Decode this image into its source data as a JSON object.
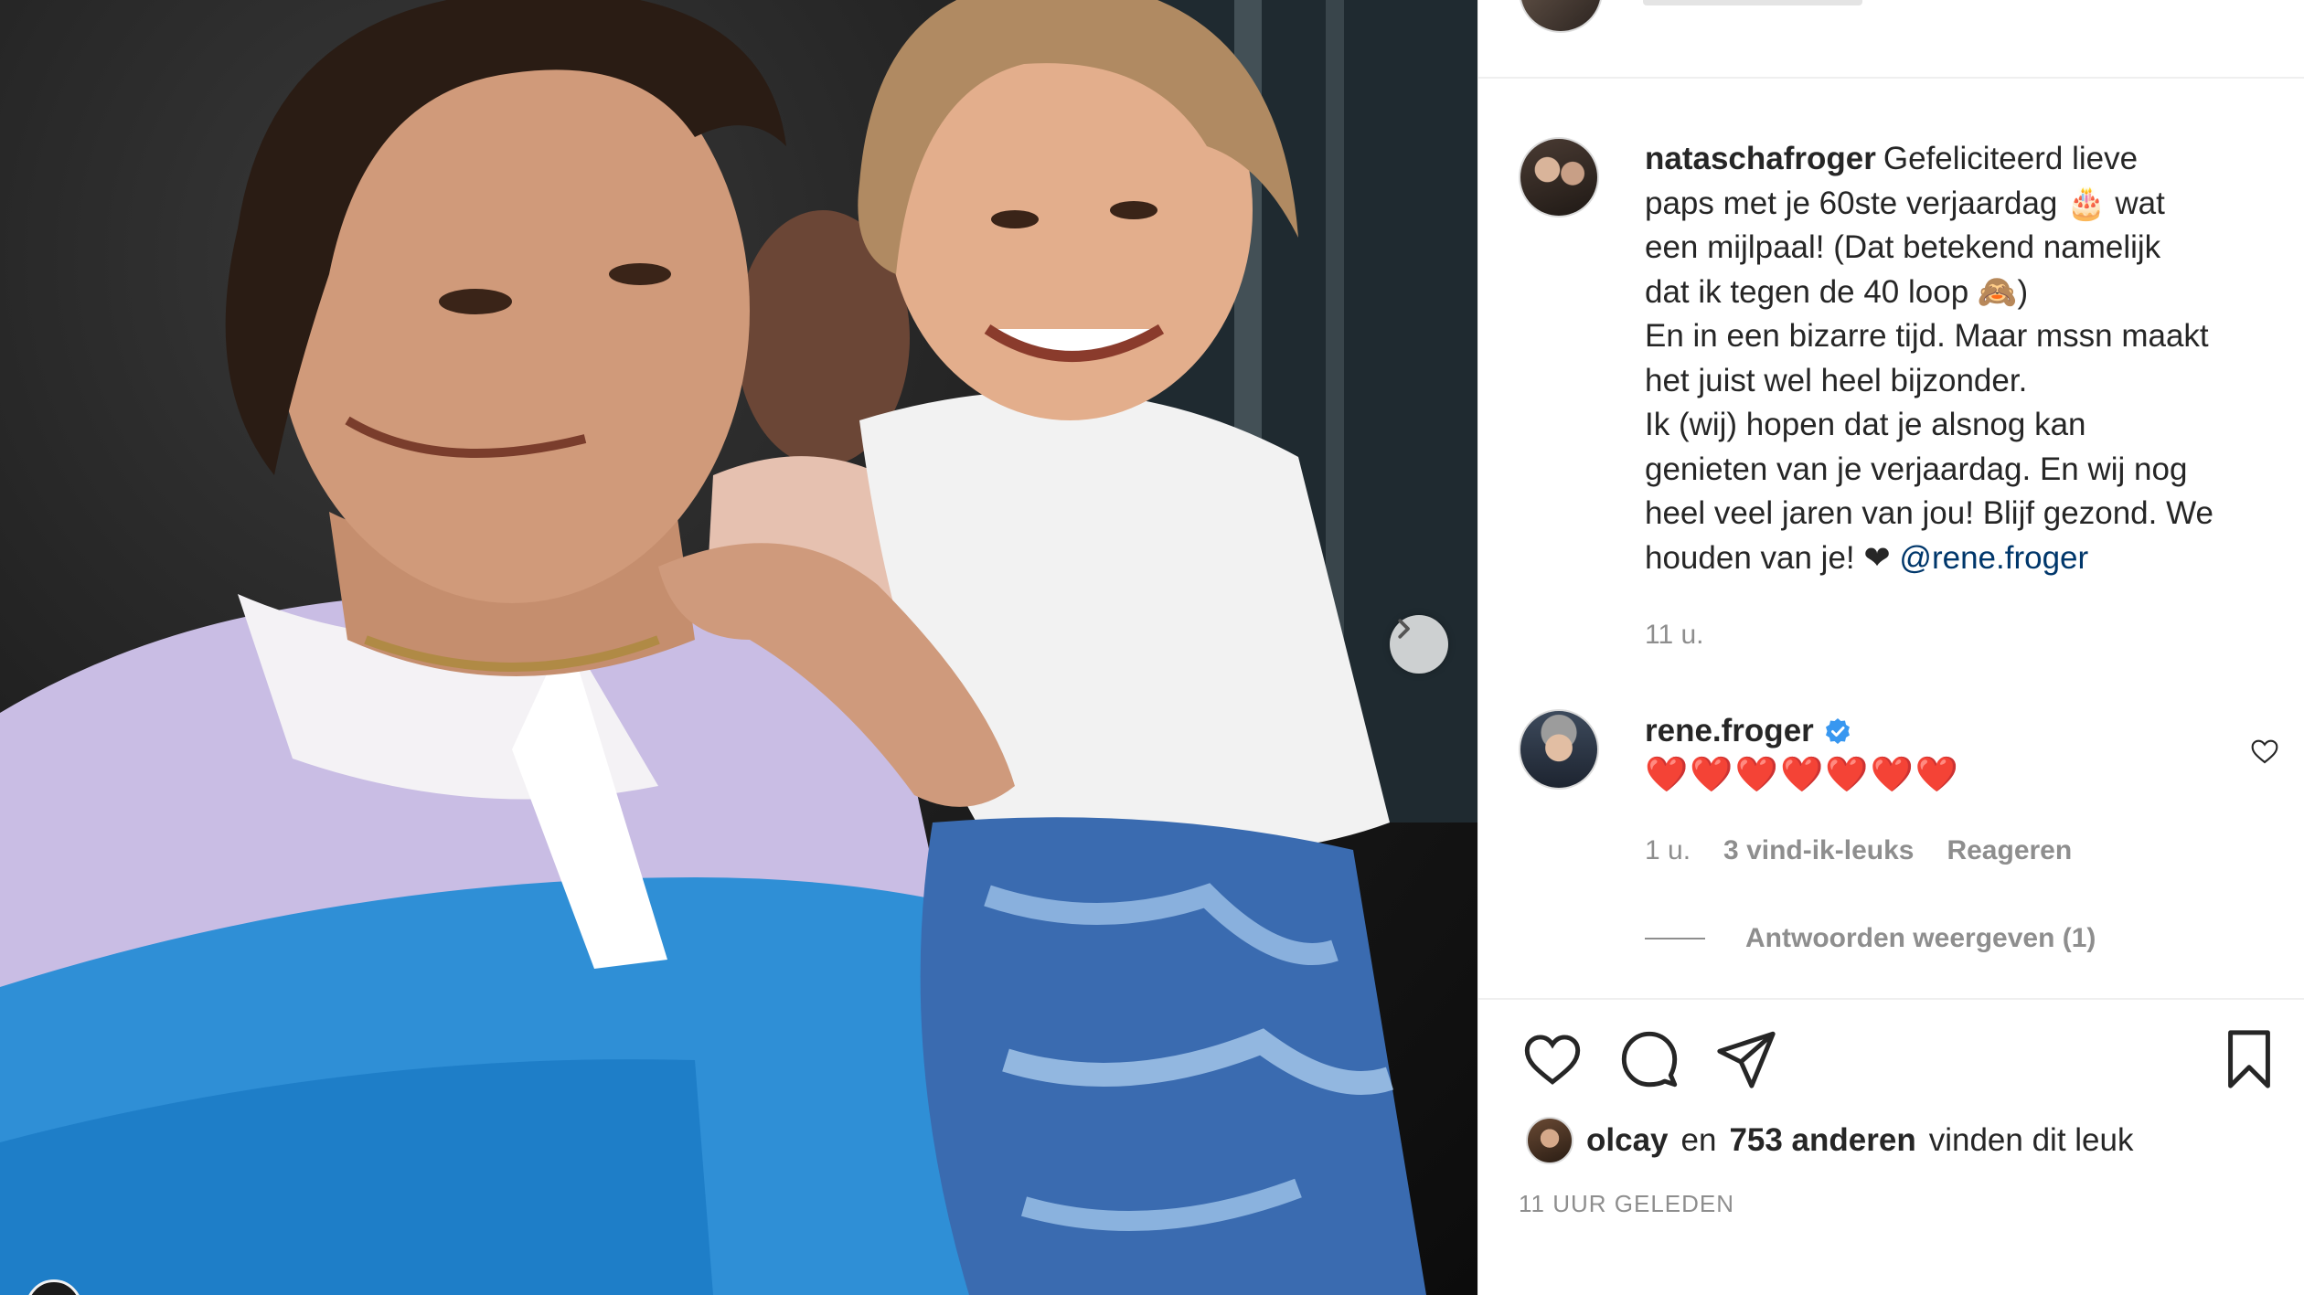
{
  "post": {
    "author": "nataschafroger",
    "caption_lines": [
      "Gefeliciteerd lieve",
      "paps met je 60ste verjaardag 🎂 wat",
      "een mijlpaal! (Dat betekend namelijk",
      "dat ik tegen de 40 loop 🙈)",
      "En in een bizarre tijd. Maar mssn maakt",
      "het juist wel heel bijzonder.",
      "Ik (wij) hopen dat je alsnog kan",
      "genieten van je verjaardag. En wij nog",
      "heel veel jaren van jou! Blijf gezond. We",
      "houden van je! ❤"
    ],
    "mention": "@rene.froger",
    "caption_time": "11 u."
  },
  "comment": {
    "user": "rene.froger",
    "text": "❤️❤️❤️❤️❤️❤️❤️",
    "time": "1 u.",
    "likes": "3 vind-ik-leuks",
    "reply": "Reageren",
    "view_replies": "Antwoorden weergeven (1)"
  },
  "likes": {
    "user": "olcay",
    "connector": "en",
    "others": "753 anderen",
    "suffix": "vinden dit leuk"
  },
  "posted_ago": "11 UUR GELEDEN",
  "icons": {
    "next": "chevron-right-icon",
    "like": "heart-icon",
    "comment": "comment-bubble-icon",
    "share": "paper-plane-icon",
    "save": "bookmark-icon",
    "verified": "verified-badge-icon"
  },
  "colors": {
    "mention": "#00376b",
    "verified": "#3897f0",
    "meta_gray": "#8e8e8e",
    "heart_red": "#ed4956"
  }
}
